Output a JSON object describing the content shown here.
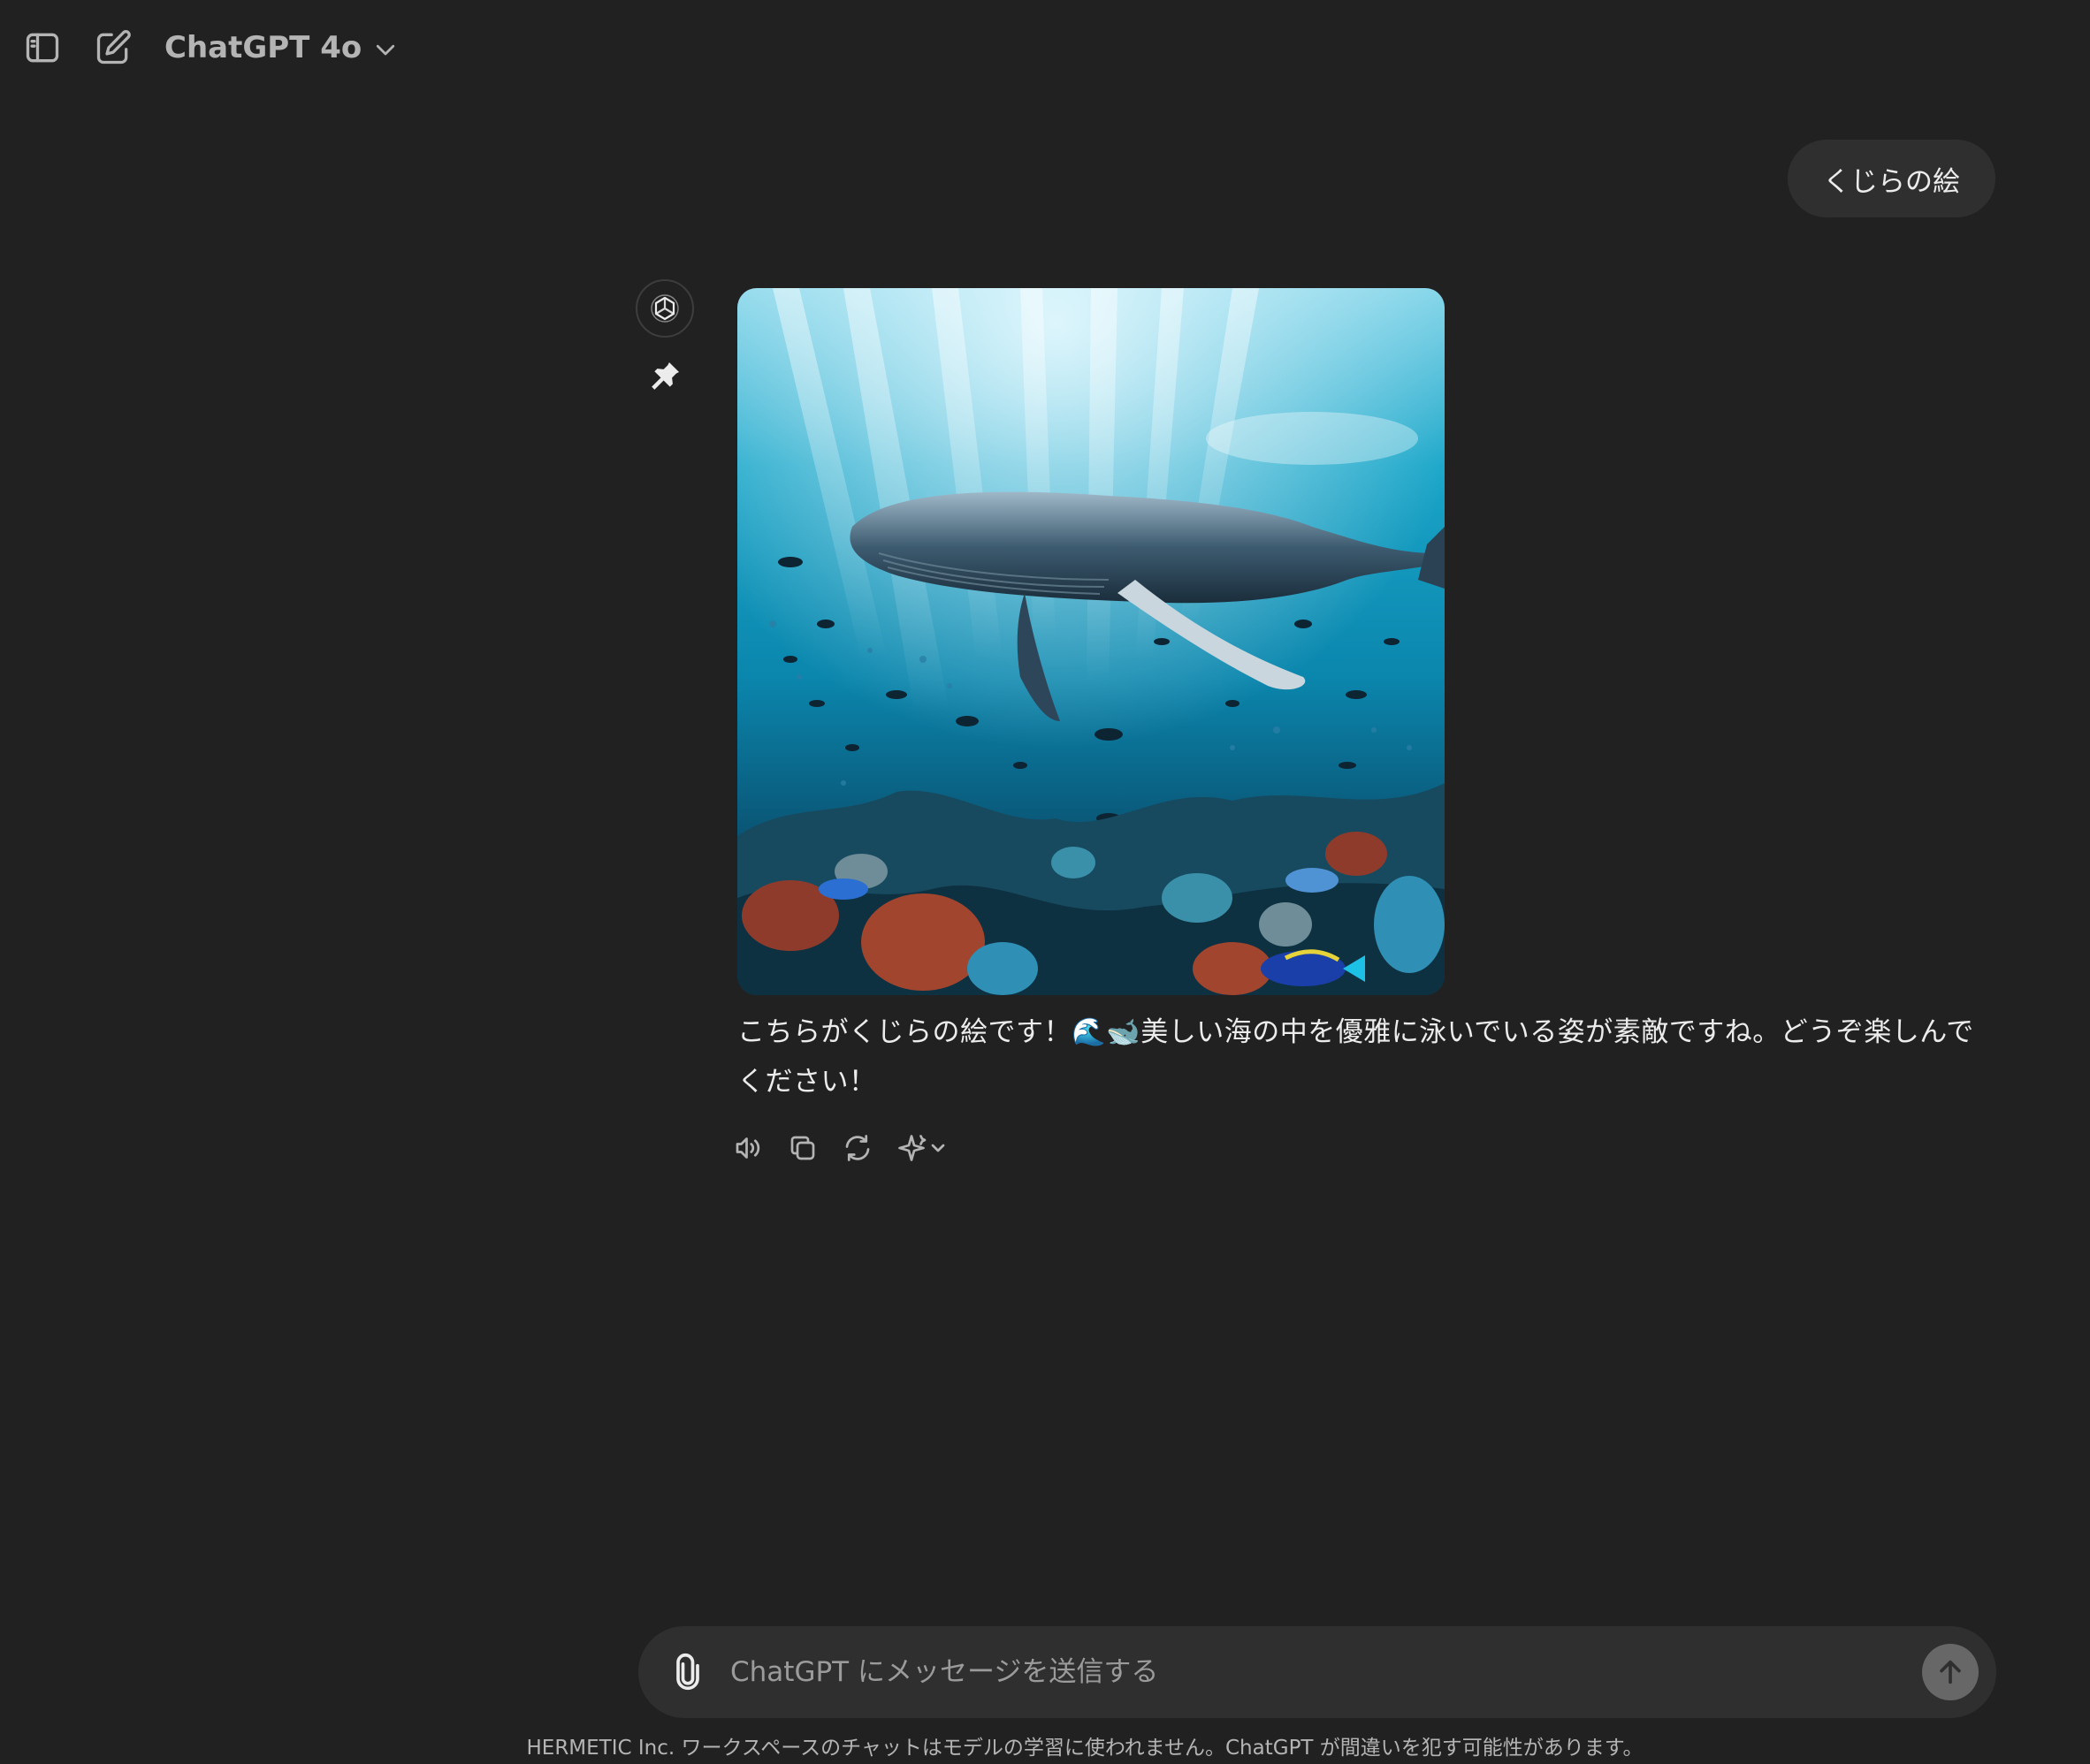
{
  "header": {
    "model_name": "ChatGPT 4o",
    "icons": {
      "sidebar": "sidebar-toggle-icon",
      "new_chat": "new-chat-icon",
      "model_dropdown": "chevron-down-icon"
    }
  },
  "conversation": {
    "user_message": "くじらの絵",
    "assistant": {
      "avatar_icon": "openai-logo-icon",
      "pin_icon": "pin-icon",
      "image_subject": "humpback whale swimming over a coral reef with fish and sunbeams",
      "text_before_emoji": "こちらがくじらの絵です！",
      "emoji": "🌊🐋",
      "text_after_emoji": "美しい海の中を優雅に泳いでいる姿が素敵ですね。どうぞ楽しんでください！",
      "actions": [
        {
          "icon": "read-aloud-icon"
        },
        {
          "icon": "copy-icon"
        },
        {
          "icon": "regenerate-icon"
        },
        {
          "icon": "sparkle-dropdown-icon"
        }
      ]
    }
  },
  "composer": {
    "placeholder": "ChatGPT にメッセージを送信する",
    "value": "",
    "attach_icon": "paperclip-icon",
    "send_icon": "arrow-up-icon"
  },
  "footer": {
    "disclaimer": "HERMETIC Inc. ワークスペースのチャットはモデルの学習に使われません。ChatGPT が間違いを犯す可能性があります。"
  },
  "colors": {
    "background": "#212121",
    "bubble": "#2f2f2f",
    "text": "#ececec",
    "muted_text": "#b4b4b4",
    "send_button": "#676767"
  }
}
